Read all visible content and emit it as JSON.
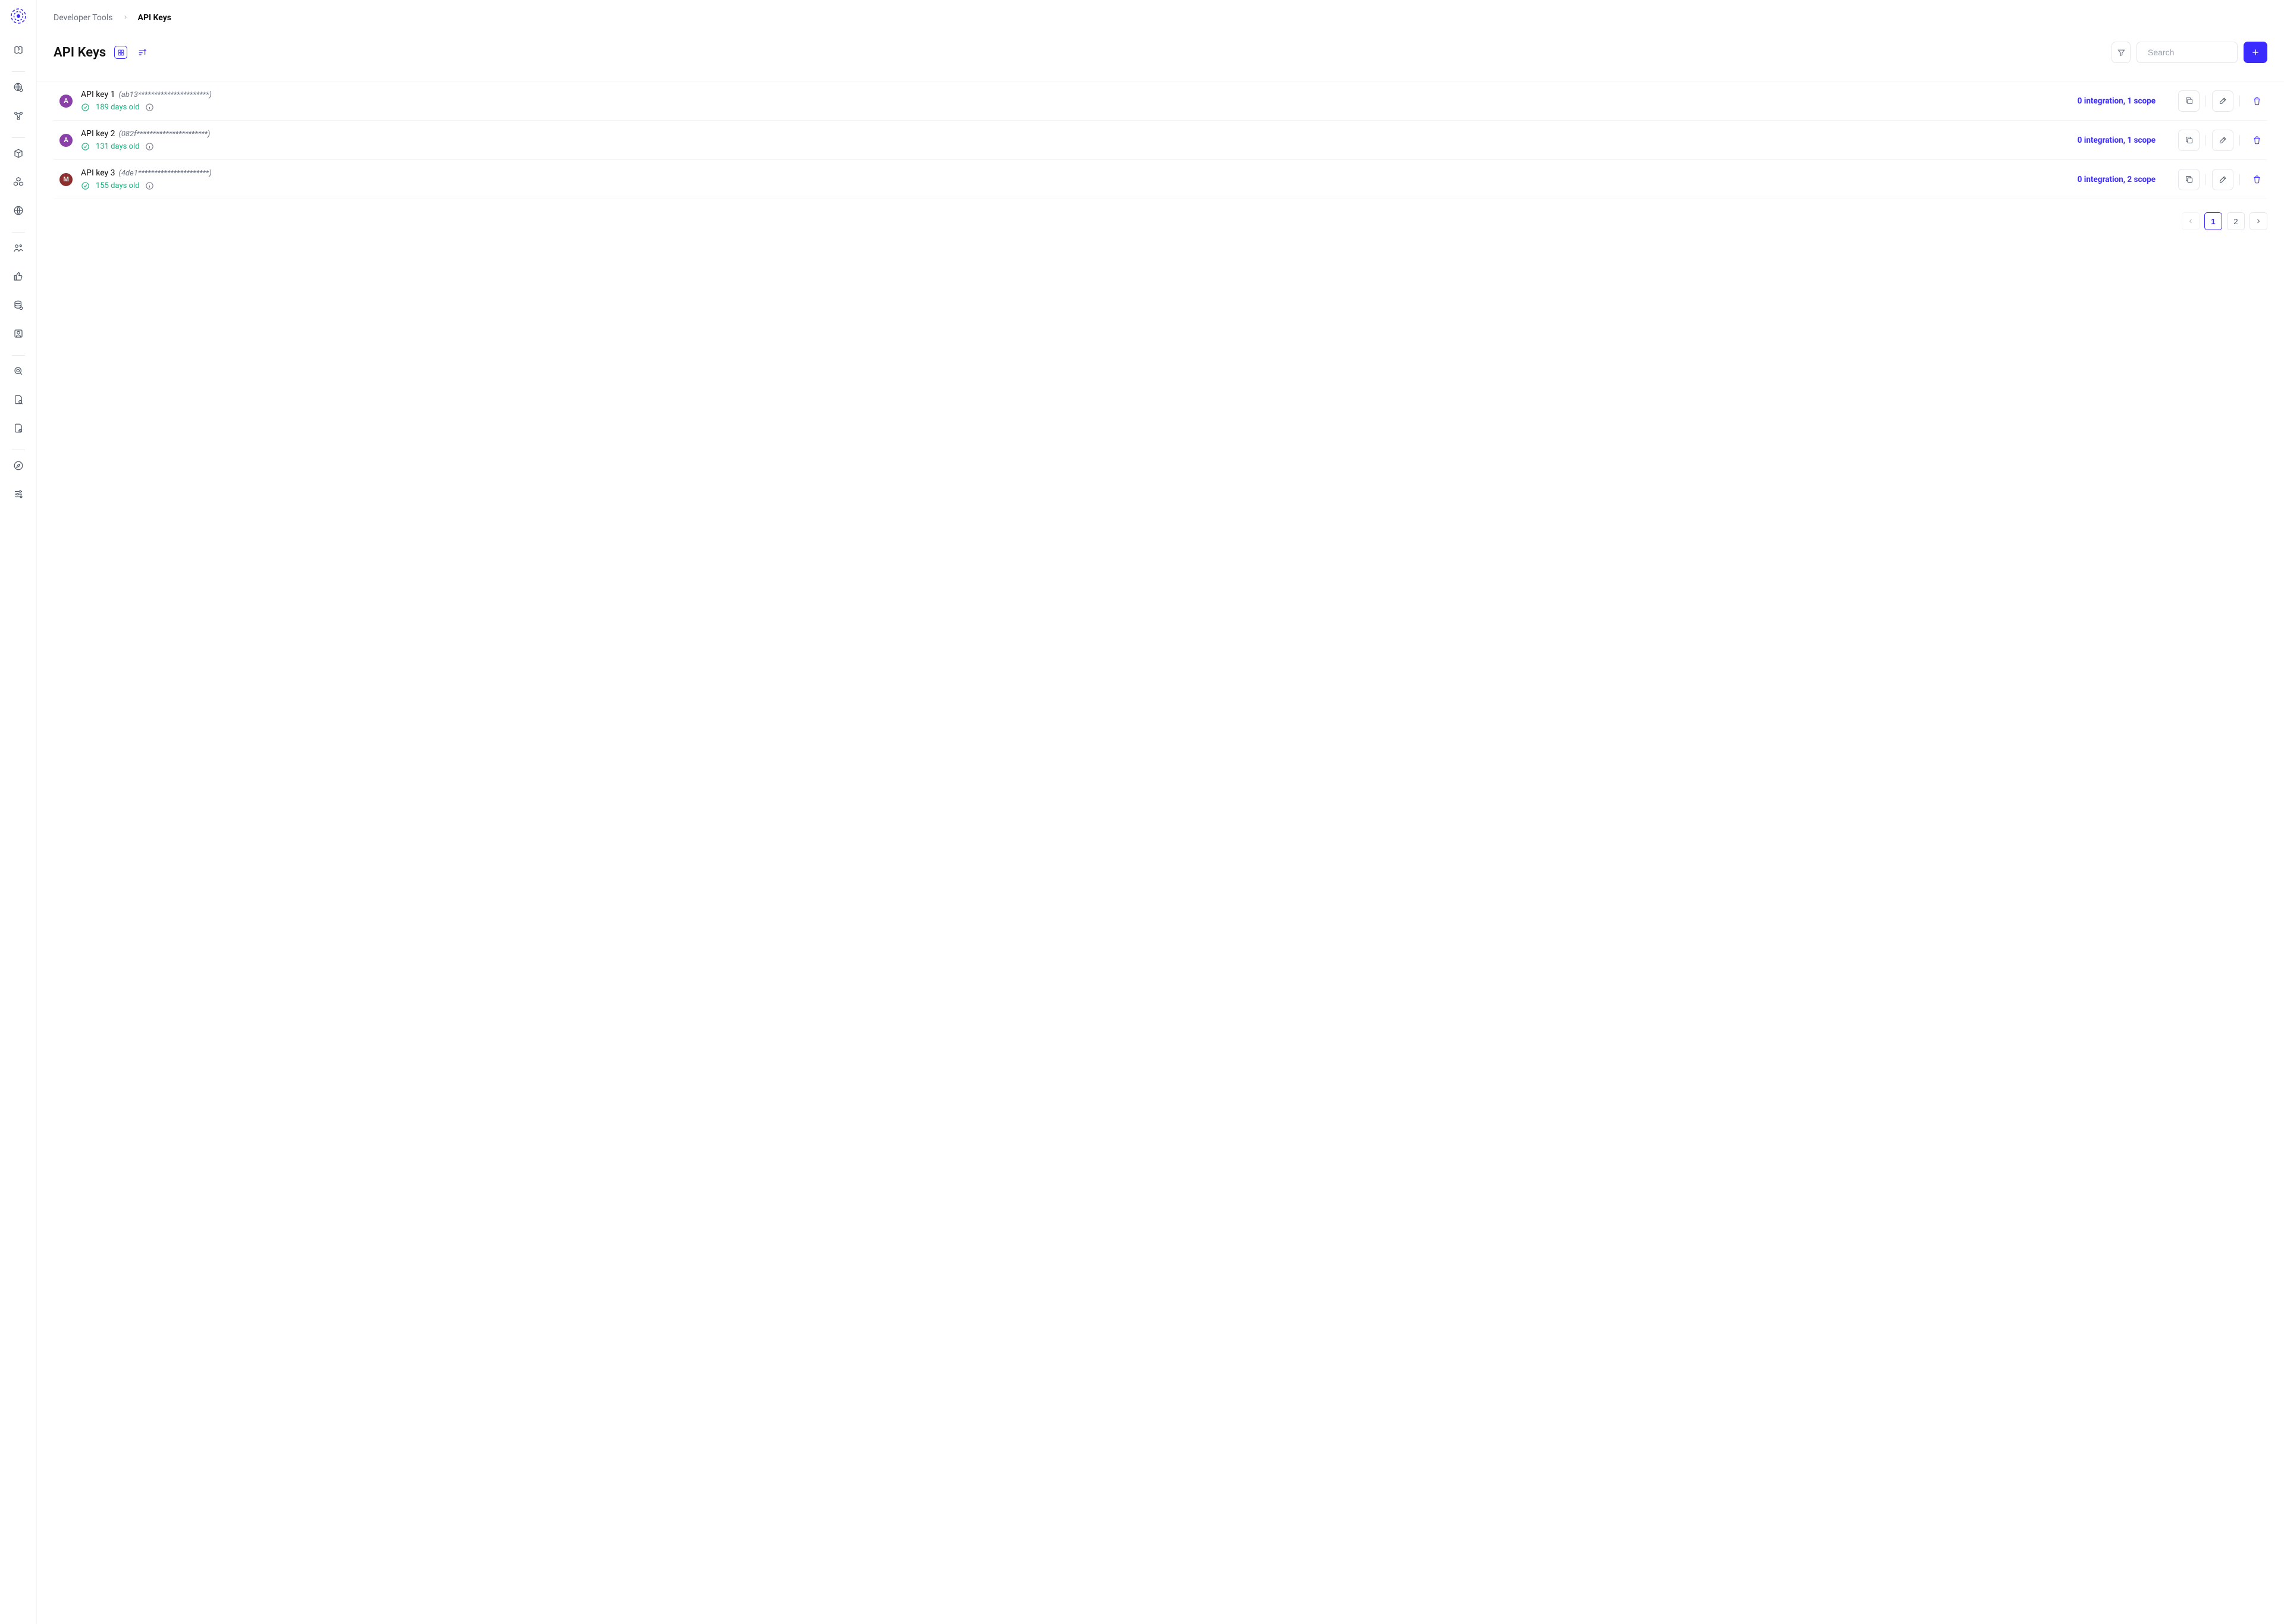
{
  "breadcrumb": {
    "parent": "Developer Tools",
    "current": "API Keys"
  },
  "header": {
    "title": "API Keys",
    "search_placeholder": "Search"
  },
  "list": [
    {
      "avatar_letter": "A",
      "avatar_color": "purple",
      "name": "API key 1",
      "mask": "ab13**********************",
      "age": "189 days old",
      "meta": "0 integration, 1 scope"
    },
    {
      "avatar_letter": "A",
      "avatar_color": "purple",
      "name": "API key 2",
      "mask": "082f**********************",
      "age": "131 days old",
      "meta": "0 integration, 1 scope"
    },
    {
      "avatar_letter": "M",
      "avatar_color": "maroon",
      "name": "API key 3",
      "mask": "4de1**********************",
      "age": "155 days old",
      "meta": "0 integration, 2 scope"
    }
  ],
  "pagination": {
    "pages": [
      "1",
      "2"
    ],
    "active": 0
  }
}
